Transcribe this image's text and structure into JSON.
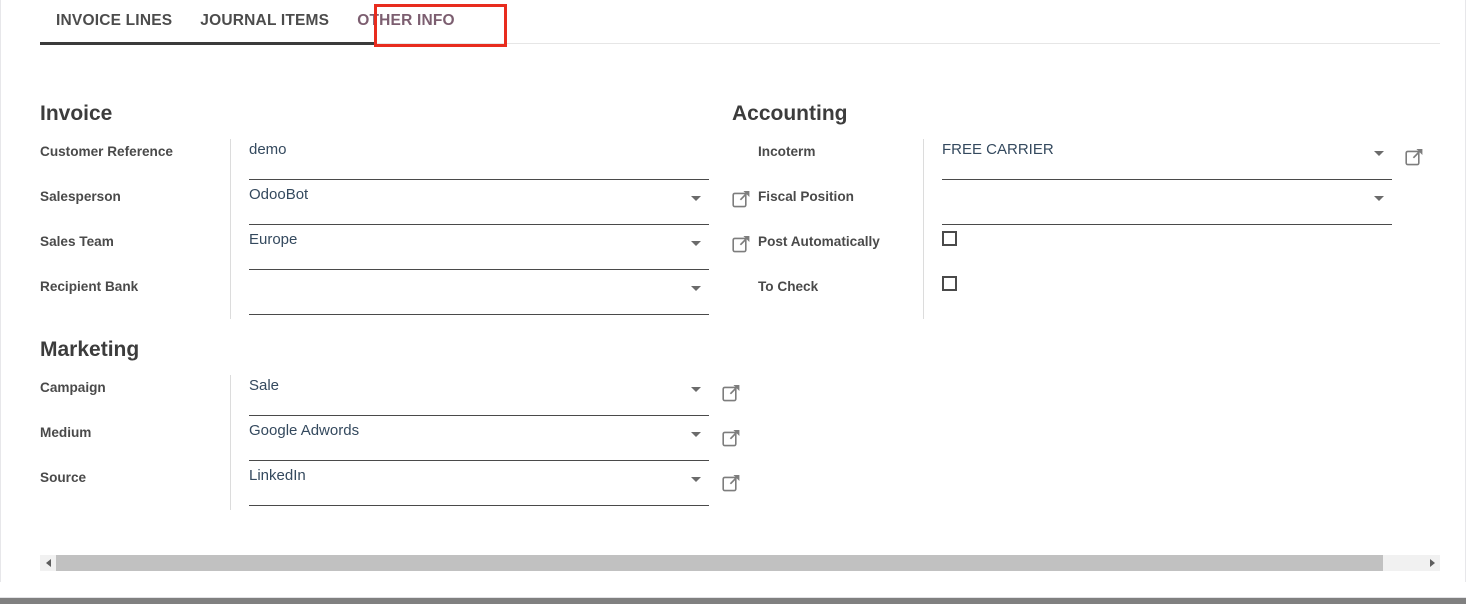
{
  "tabs": [
    {
      "label": "INVOICE LINES",
      "active": false
    },
    {
      "label": "JOURNAL ITEMS",
      "active": false
    },
    {
      "label": "OTHER INFO",
      "active": true,
      "highlighted": true
    }
  ],
  "groups": {
    "invoice": {
      "title": "Invoice",
      "fields": [
        {
          "label": "Customer Reference",
          "value": "demo",
          "type": "text",
          "caret": false,
          "link_left": false,
          "link_right": false
        },
        {
          "label": "Salesperson",
          "value": "OdooBot",
          "type": "select",
          "caret": true,
          "link_left": false,
          "link_right": false
        },
        {
          "label": "Sales Team",
          "value": "Europe",
          "type": "select",
          "caret": true,
          "link_left": false,
          "link_right": false
        },
        {
          "label": "Recipient Bank",
          "value": "",
          "type": "select",
          "caret": true,
          "link_left": false,
          "link_right": false
        }
      ]
    },
    "accounting": {
      "title": "Accounting",
      "fields": [
        {
          "label": "Incoterm",
          "value": "FREE CARRIER",
          "type": "select",
          "caret": true,
          "link_left": false,
          "link_right": true
        },
        {
          "label": "Fiscal Position",
          "value": "",
          "type": "select",
          "caret": true,
          "link_left": true,
          "link_right": false
        },
        {
          "label": "Post Automatically",
          "value": false,
          "type": "checkbox",
          "caret": false,
          "link_left": true,
          "link_right": false
        },
        {
          "label": "To Check",
          "value": false,
          "type": "checkbox",
          "caret": false,
          "link_left": false,
          "link_right": false
        }
      ]
    },
    "marketing": {
      "title": "Marketing",
      "fields": [
        {
          "label": "Campaign",
          "value": "Sale",
          "type": "select",
          "caret": true,
          "link_left": false,
          "link_right": true
        },
        {
          "label": "Medium",
          "value": "Google Adwords",
          "type": "select",
          "caret": true,
          "link_left": false,
          "link_right": true
        },
        {
          "label": "Source",
          "value": "LinkedIn",
          "type": "select",
          "caret": true,
          "link_left": false,
          "link_right": true
        }
      ]
    }
  },
  "icons": {
    "external_link": "external-link-icon",
    "dropdown_caret": "chevron-down-icon",
    "scroll_left": "scroll-left-arrow-icon",
    "scroll_right": "scroll-right-arrow-icon"
  },
  "colors": {
    "tab_active_text": "#7c5e70",
    "tab_text": "#4c4c4c",
    "highlight_box": "#e82c1e",
    "field_text": "#34495e",
    "label_text": "#4a4a4a",
    "underline": "#4a4a4a",
    "scrollbar_thumb": "#c1c1c1",
    "bottom_bar": "#808080"
  },
  "scrollbar": {
    "orientation": "horizontal",
    "thumb_percent": 97
  }
}
